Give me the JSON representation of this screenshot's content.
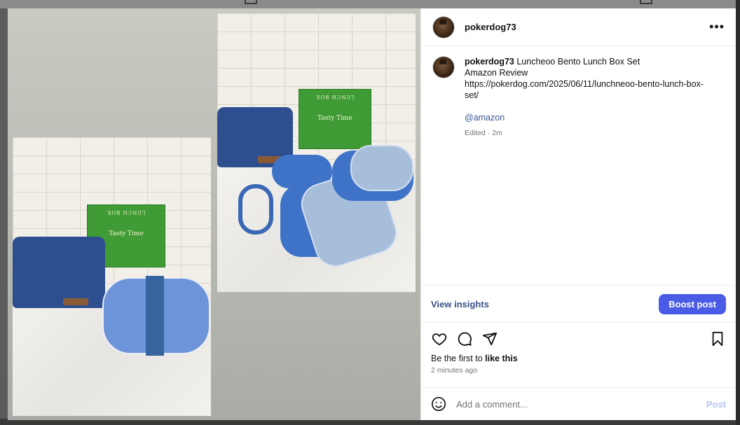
{
  "post": {
    "username": "pokerdog73",
    "more_icon": "more-horizontal-icon"
  },
  "caption": {
    "username": "pokerdog73",
    "text_line1": "Luncheoo Bento Lunch Box Set",
    "text_line2": "Amazon Review",
    "text_line3": "https://pokerdog.com/2025/06/11/lunchneoo-bento-lunch-box-",
    "text_line4": "set/",
    "mention": "@amazon",
    "meta": "Edited · 2m"
  },
  "insights": {
    "view_label": "View insights",
    "boost_label": "Boost post"
  },
  "actions": {
    "likes_prefix": "Be the first to ",
    "likes_strong": "like this",
    "time_ago": "2 minutes ago"
  },
  "comment": {
    "placeholder": "Add a comment...",
    "post_label": "Post"
  },
  "media": {
    "box_label": "LUNCH BOX",
    "box_brand": "Tasty Time"
  },
  "colors": {
    "accent": "#4a5ce6",
    "link": "#385185"
  }
}
